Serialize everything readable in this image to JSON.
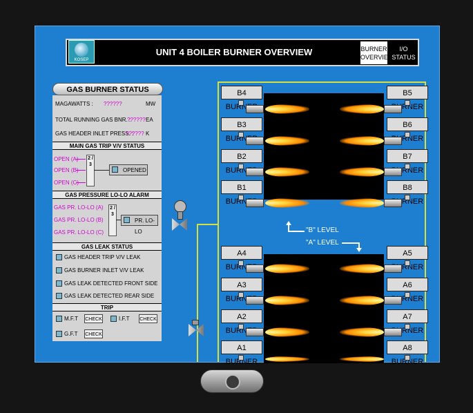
{
  "header": {
    "title": "UNIT 4 BOILER BURNER OVERVIEW",
    "logo_text": "KOSEP",
    "nav": [
      {
        "line1": "BURNER",
        "line2": "OVERVIEW"
      },
      {
        "line1": "I/O",
        "line2": "STATUS"
      }
    ]
  },
  "gas_burner_status": {
    "title": "GAS BURNER STATUS",
    "rows": [
      {
        "label": "MAGAWATTS :",
        "value": "??????",
        "unit": "MW"
      },
      {
        "label": "TOTAL RUNNING GAS BNR. :",
        "value": "??????",
        "unit": "EA"
      },
      {
        "label": "GAS HEADER INLET PRESS. :",
        "value": "??????",
        "unit": "K"
      }
    ]
  },
  "main_gas_trip": {
    "title": "MAIN GAS TRIP V/V STATUS",
    "items": [
      "OPEN (A)",
      "OPEN (B)",
      "OPEN (C)"
    ],
    "vote": "2 / 3",
    "status": "OPENED"
  },
  "gas_pressure": {
    "title": "GAS PRESSURE LO-LO ALARM",
    "items": [
      "GAS PR. LO-LO (A)",
      "GAS PR. LO-LO (B)",
      "GAS PR. LO-LO (C)"
    ],
    "vote": "2 / 3",
    "status": "PR. LO-LO"
  },
  "gas_leak": {
    "title": "GAS LEAK STATUS",
    "items": [
      "GAS HEADER TRIP V/V LEAK",
      "GAS BURNER INLET V/V LEAK",
      "GAS LEAK DETECTED FRONT SIDE",
      "GAS LEAK DETECTED REAR SIDE"
    ]
  },
  "trip": {
    "title": "TRIP",
    "items": [
      {
        "label": "M.F.T",
        "button": "CHECK"
      },
      {
        "label": "I.F.T",
        "button": "CHECK"
      },
      {
        "label": "G.F.T",
        "button": "CHECK"
      }
    ]
  },
  "burners": {
    "left_upper": [
      "B4 BURNER",
      "B3 BURNER",
      "B2 BURNER",
      "B1 BURNER"
    ],
    "right_upper": [
      "B5 BURNER",
      "B6 BURNER",
      "B7 BURNER",
      "B8 BURNER"
    ],
    "left_lower": [
      "A4 BURNER",
      "A3 BURNER",
      "A2 BURNER",
      "A1 BURNER"
    ],
    "right_lower": [
      "A5 BURNER",
      "A6 BURNER",
      "A7 BURNER",
      "A8 BURNER"
    ]
  },
  "levels": {
    "b": "\"B\" LEVEL",
    "a": "\"A\" LEVEL"
  },
  "colors": {
    "screen": "#1e7fd0",
    "alarm_text": "#d000d0",
    "pipe": "#d8e040"
  }
}
